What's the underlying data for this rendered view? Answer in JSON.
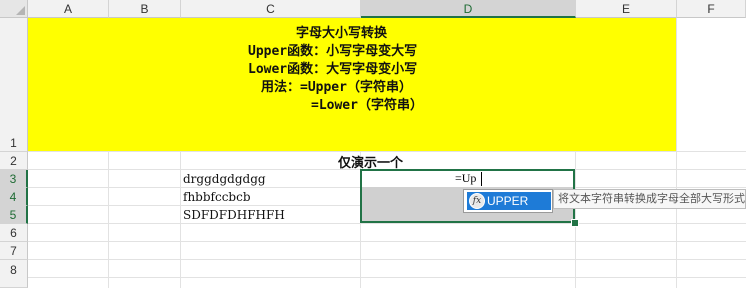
{
  "columns": [
    "A",
    "B",
    "C",
    "D",
    "E",
    "F"
  ],
  "rows": [
    "1",
    "2",
    "3",
    "4",
    "5",
    "6",
    "7",
    "8"
  ],
  "banner": {
    "lines": [
      "字母大小写转换",
      "Upper函数：小写字母变大写",
      "Lower函数：大写字母变小写",
      "用法：=Upper（字符串）",
      "=Lower（字符串）"
    ]
  },
  "row2": {
    "caption": "仅演示一个"
  },
  "data_cells": [
    "drggdgdgdgg",
    "fhbbfccbcb",
    "SDFDFDHFHFH"
  ],
  "editing": {
    "formula": "=Up"
  },
  "autocomplete": {
    "icon": "function-fx-icon",
    "icon_glyph": "fx",
    "item": "UPPER",
    "tooltip": "将文本字符串转换成字母全部大写形式"
  },
  "colors": {
    "banner": "#ffff00",
    "selection": "#217346",
    "autocomplete_highlight": "#1e7bd7"
  }
}
